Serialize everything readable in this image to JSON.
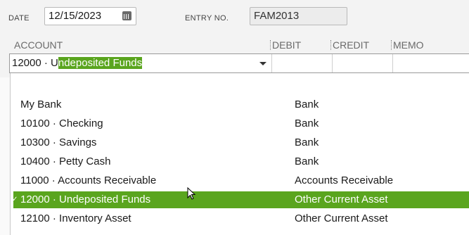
{
  "header": {
    "date_label": "DATE",
    "date_value": "12/15/2023",
    "entry_label": "ENTRY NO.",
    "entry_value": "FAM2013"
  },
  "columns": {
    "account": "ACCOUNT",
    "debit": "DEBIT",
    "credit": "CREDIT",
    "memo": "MEMO"
  },
  "account_input": {
    "prefix": "12000 · U",
    "highlighted": "ndeposited Funds"
  },
  "accounts": [
    {
      "name": "My Bank",
      "type": "Bank"
    },
    {
      "name": "10100 · Checking",
      "type": "Bank"
    },
    {
      "name": "10300 · Savings",
      "type": "Bank"
    },
    {
      "name": "10400 · Petty Cash",
      "type": "Bank"
    },
    {
      "name": "11000 · Accounts Receivable",
      "type": "Accounts Receivable"
    },
    {
      "name": "12000 · Undeposited Funds",
      "type": "Other Current Asset",
      "selected": true
    },
    {
      "name": "12100 · Inventory Asset",
      "type": "Other Current Asset"
    }
  ],
  "colors": {
    "selection": "#5aa51e"
  }
}
